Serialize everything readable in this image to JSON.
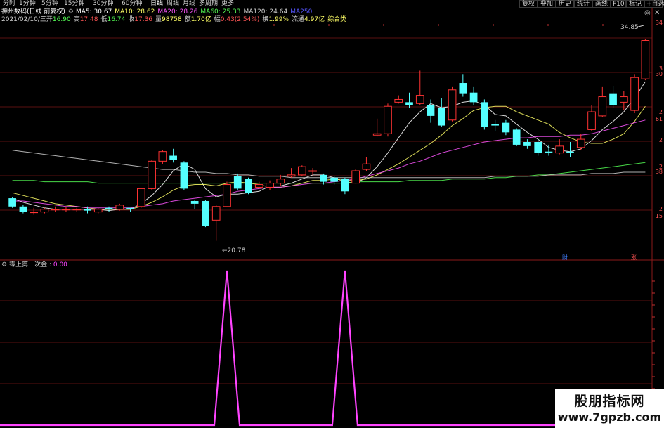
{
  "toolbar": {
    "periods": [
      "分时",
      "1分钟",
      "5分钟",
      "15分钟",
      "30分钟",
      "60分钟",
      "日线",
      "周线",
      "月线",
      "多周期",
      "更多"
    ],
    "active_period": "日线",
    "buttons": [
      "复权",
      "叠加",
      "历史",
      "统计",
      "画线",
      "F10",
      "标记",
      "+自选"
    ]
  },
  "header": {
    "stock_name": "神州数码",
    "adjust_mode": "(日线 前复权)",
    "ma": [
      {
        "label": "MA5:",
        "value": "30.67",
        "color": "#ffffff"
      },
      {
        "label": "MA10:",
        "value": "28.62",
        "color": "#ffff66"
      },
      {
        "label": "MA20:",
        "value": "28.26",
        "color": "#ff55ff"
      },
      {
        "label": "MA60:",
        "value": "25.33",
        "color": "#55ff55"
      },
      {
        "label": "MA120:",
        "value": "24.64",
        "color": "#d0d0d0"
      },
      {
        "label": "MA250",
        "value": "",
        "color": "#5555ff"
      }
    ]
  },
  "quote": {
    "date": "2021/02/10/三",
    "open_label": "开",
    "open": "16.90",
    "high_label": "高",
    "high": "17.48",
    "low_label": "低",
    "low": "16.74",
    "close_label": "收",
    "close": "17.36",
    "volume_label": "量",
    "volume": "98758",
    "amount_label": "额",
    "amount": "1.70亿",
    "change_label": "幅",
    "change": "0.43(2.54%)",
    "turnover_label": "换",
    "turnover": "1.99%",
    "float_label": "流通",
    "float_value": "4.97亿",
    "category": "综合类"
  },
  "chart_annotations": {
    "high_label": "34.85",
    "low_label": "20.78"
  },
  "markers": {
    "finance": "财",
    "rise": "涨"
  },
  "price_axis_labels": [
    "34",
    "3",
    "30",
    "2",
    "61",
    "2",
    "2",
    "38",
    "2",
    "15"
  ],
  "indicator": {
    "name": "零上第一次金",
    "value": "0.00",
    "color": "#ff44ff"
  },
  "chart_data": [
    {
      "type": "candlestick",
      "title": "",
      "ylim": [
        19.5,
        36.5
      ],
      "high_marker": 34.85,
      "low_marker": 20.78,
      "candles": [
        [
          23.9,
          23.3,
          24.0,
          23.2
        ],
        [
          23.3,
          22.9,
          23.4,
          22.8
        ],
        [
          22.9,
          22.9,
          23.2,
          22.7
        ],
        [
          22.9,
          23.1,
          23.2,
          22.8
        ],
        [
          23.1,
          23.1,
          23.3,
          22.9
        ],
        [
          23.1,
          23.1,
          23.3,
          22.9
        ],
        [
          23.1,
          23.1,
          23.2,
          22.9
        ],
        [
          23.1,
          23.0,
          23.3,
          22.8
        ],
        [
          22.9,
          23.1,
          23.2,
          22.8
        ],
        [
          23.2,
          23.1,
          23.3,
          22.9
        ],
        [
          23.1,
          23.4,
          23.5,
          23.0
        ],
        [
          23.2,
          23.1,
          23.2,
          22.9
        ],
        [
          23.3,
          24.6,
          24.6,
          23.2
        ],
        [
          24.6,
          26.6,
          26.7,
          24.5
        ],
        [
          26.6,
          27.3,
          27.4,
          26.4
        ],
        [
          27.0,
          26.7,
          27.5,
          26.5
        ],
        [
          26.5,
          24.6,
          26.6,
          24.5
        ],
        [
          23.7,
          23.5,
          23.8,
          23.1
        ],
        [
          23.7,
          21.9,
          23.8,
          21.8
        ],
        [
          22.3,
          23.3,
          23.4,
          20.8
        ],
        [
          23.3,
          24.9,
          25.1,
          23.3
        ],
        [
          25.5,
          24.6,
          25.7,
          24.5
        ],
        [
          25.3,
          24.3,
          25.4,
          24.2
        ],
        [
          24.7,
          24.9,
          25.1,
          24.6
        ],
        [
          24.7,
          25.0,
          25.2,
          24.5
        ],
        [
          25.0,
          25.3,
          25.6,
          24.8
        ],
        [
          25.5,
          25.6,
          26.1,
          25.4
        ],
        [
          25.6,
          26.2,
          26.3,
          25.5
        ],
        [
          25.9,
          25.9,
          26.1,
          25.6
        ],
        [
          25.6,
          25.1,
          25.7,
          24.9
        ],
        [
          25.4,
          25.1,
          25.5,
          24.9
        ],
        [
          25.3,
          24.4,
          25.4,
          24.2
        ],
        [
          25.0,
          25.9,
          26.0,
          25.0
        ],
        [
          26.0,
          26.4,
          26.9,
          25.9
        ],
        [
          28.5,
          28.6,
          29.7,
          28.4
        ],
        [
          28.6,
          30.6,
          30.8,
          28.4
        ],
        [
          30.9,
          31.1,
          31.4,
          30.8
        ],
        [
          30.9,
          30.7,
          31.6,
          30.5
        ],
        [
          30.8,
          31.4,
          33.2,
          30.7
        ],
        [
          30.7,
          29.9,
          31.1,
          29.4
        ],
        [
          30.5,
          29.2,
          31.2,
          29.1
        ],
        [
          29.6,
          31.8,
          32.0,
          29.5
        ],
        [
          32.3,
          31.5,
          32.9,
          31.3
        ],
        [
          31.6,
          30.9,
          32.0,
          30.7
        ],
        [
          30.9,
          29.1,
          31.1,
          28.9
        ],
        [
          29.3,
          29.2,
          29.6,
          28.8
        ],
        [
          29.4,
          28.7,
          29.6,
          28.5
        ],
        [
          28.9,
          27.8,
          29.0,
          27.7
        ],
        [
          28.0,
          27.7,
          28.2,
          27.5
        ],
        [
          28.0,
          27.2,
          28.2,
          27.0
        ],
        [
          27.3,
          27.2,
          27.8,
          27.0
        ],
        [
          27.2,
          27.7,
          28.2,
          27.1
        ],
        [
          27.3,
          27.2,
          28.0,
          26.9
        ],
        [
          27.6,
          28.2,
          28.6,
          27.4
        ],
        [
          28.9,
          30.2,
          30.7,
          28.8
        ],
        [
          29.9,
          31.3,
          32.0,
          29.8
        ],
        [
          31.5,
          30.7,
          32.1,
          30.5
        ],
        [
          30.9,
          31.3,
          31.7,
          30.3
        ],
        [
          30.3,
          32.7,
          32.9,
          30.1
        ],
        [
          32.6,
          35.4,
          35.5,
          32.5
        ]
      ],
      "ma_series": [
        {
          "name": "MA5",
          "color": "#ffffff",
          "values": [
            23.9,
            23.6,
            23.4,
            23.2,
            23.1,
            23.1,
            23.1,
            23.1,
            23.1,
            23.0,
            23.1,
            23.1,
            23.5,
            24.1,
            24.9,
            25.9,
            26.4,
            26.0,
            24.6,
            24.0,
            24.2,
            24.2,
            24.3,
            24.4,
            24.8,
            24.8,
            25.0,
            25.3,
            25.6,
            25.6,
            25.4,
            25.1,
            25.0,
            25.4,
            26.2,
            27.2,
            28.3,
            29.4,
            30.2,
            30.8,
            30.5,
            30.6,
            30.9,
            31.0,
            30.7,
            30.0,
            29.9,
            29.3,
            28.7,
            28.2,
            27.6,
            27.4,
            27.3,
            27.5,
            28.1,
            28.9,
            29.5,
            30.2,
            31.2,
            32.4
          ]
        },
        {
          "name": "MA10",
          "color": "#ffff66",
          "values": [
            24.3,
            24.1,
            23.9,
            23.7,
            23.5,
            23.4,
            23.3,
            23.2,
            23.1,
            23.1,
            23.1,
            23.1,
            23.3,
            23.6,
            24.0,
            24.5,
            24.8,
            24.9,
            24.9,
            24.8,
            25.0,
            25.1,
            25.0,
            24.9,
            24.7,
            24.7,
            24.8,
            25.0,
            25.2,
            25.2,
            25.3,
            25.2,
            25.2,
            25.3,
            25.6,
            26.0,
            26.4,
            26.9,
            27.4,
            27.9,
            28.5,
            29.2,
            29.7,
            30.3,
            30.5,
            30.6,
            30.6,
            30.2,
            29.9,
            29.6,
            29.3,
            28.7,
            28.3,
            28.0,
            27.9,
            27.9,
            28.2,
            28.6,
            29.5,
            30.6
          ]
        },
        {
          "name": "MA20",
          "color": "#ff55ff",
          "values": [
            23.7,
            23.7,
            23.6,
            23.5,
            23.4,
            23.3,
            23.3,
            23.2,
            23.2,
            23.2,
            23.2,
            23.2,
            23.3,
            23.4,
            23.5,
            23.7,
            23.8,
            23.9,
            24.0,
            24.1,
            24.2,
            24.4,
            24.5,
            24.6,
            24.7,
            24.7,
            24.8,
            24.9,
            25.0,
            25.0,
            25.1,
            25.2,
            25.3,
            25.5,
            25.7,
            25.9,
            26.1,
            26.4,
            26.6,
            26.9,
            27.2,
            27.4,
            27.6,
            27.8,
            28.0,
            28.1,
            28.2,
            28.3,
            28.3,
            28.4,
            28.4,
            28.4,
            28.5,
            28.5,
            28.6,
            28.8,
            29.0,
            29.2,
            29.4,
            29.6
          ]
        },
        {
          "name": "MA60",
          "color": "#55ff55",
          "values": [
            25.2,
            25.2,
            25.2,
            25.1,
            25.1,
            25.1,
            25.1,
            25.1,
            25.0,
            25.0,
            25.0,
            25.0,
            25.0,
            25.0,
            25.0,
            25.0,
            25.0,
            25.0,
            25.0,
            25.0,
            25.0,
            25.0,
            25.0,
            25.0,
            25.0,
            25.0,
            25.0,
            25.0,
            25.0,
            25.0,
            25.0,
            25.0,
            25.1,
            25.1,
            25.1,
            25.1,
            25.1,
            25.2,
            25.2,
            25.2,
            25.2,
            25.3,
            25.3,
            25.3,
            25.3,
            25.4,
            25.4,
            25.5,
            25.5,
            25.6,
            25.6,
            25.7,
            25.8,
            25.9,
            26.0,
            26.1,
            26.2,
            26.3,
            26.4,
            26.5
          ]
        },
        {
          "name": "MA120",
          "color": "#d0d0d0",
          "values": [
            27.4,
            27.3,
            27.2,
            27.1,
            27.0,
            26.9,
            26.8,
            26.7,
            26.6,
            26.5,
            26.4,
            26.3,
            26.2,
            26.1,
            26.0,
            26.0,
            25.9,
            25.8,
            25.8,
            25.7,
            25.7,
            25.6,
            25.6,
            25.5,
            25.5,
            25.5,
            25.4,
            25.4,
            25.4,
            25.4,
            25.4,
            25.4,
            25.4,
            25.4,
            25.4,
            25.4,
            25.4,
            25.4,
            25.4,
            25.4,
            25.4,
            25.4,
            25.4,
            25.4,
            25.4,
            25.5,
            25.5,
            25.5,
            25.5,
            25.5,
            25.6,
            25.6,
            25.6,
            25.6,
            25.7,
            25.7,
            25.7,
            25.8,
            25.8,
            25.8
          ]
        }
      ]
    },
    {
      "type": "line",
      "title": "",
      "series": [
        {
          "name": "零上第一次金",
          "color": "#ff44ff",
          "values": [
            0,
            0,
            0,
            0,
            0,
            0,
            0,
            0,
            0,
            0,
            0,
            0,
            0,
            0,
            0,
            0,
            0,
            0,
            0,
            0,
            1,
            0,
            0,
            0,
            0,
            0,
            0,
            0,
            0,
            0,
            0,
            1,
            0,
            0,
            0,
            0,
            0,
            0,
            0,
            0,
            0,
            0,
            0,
            0,
            0,
            0,
            0,
            0,
            0,
            0,
            0,
            0,
            0,
            0,
            0,
            0,
            0,
            0,
            0,
            0
          ]
        }
      ],
      "ylim": [
        0,
        1
      ]
    }
  ],
  "watermark": {
    "title": "股朋指标网",
    "url": "www.7gpzb.com"
  }
}
